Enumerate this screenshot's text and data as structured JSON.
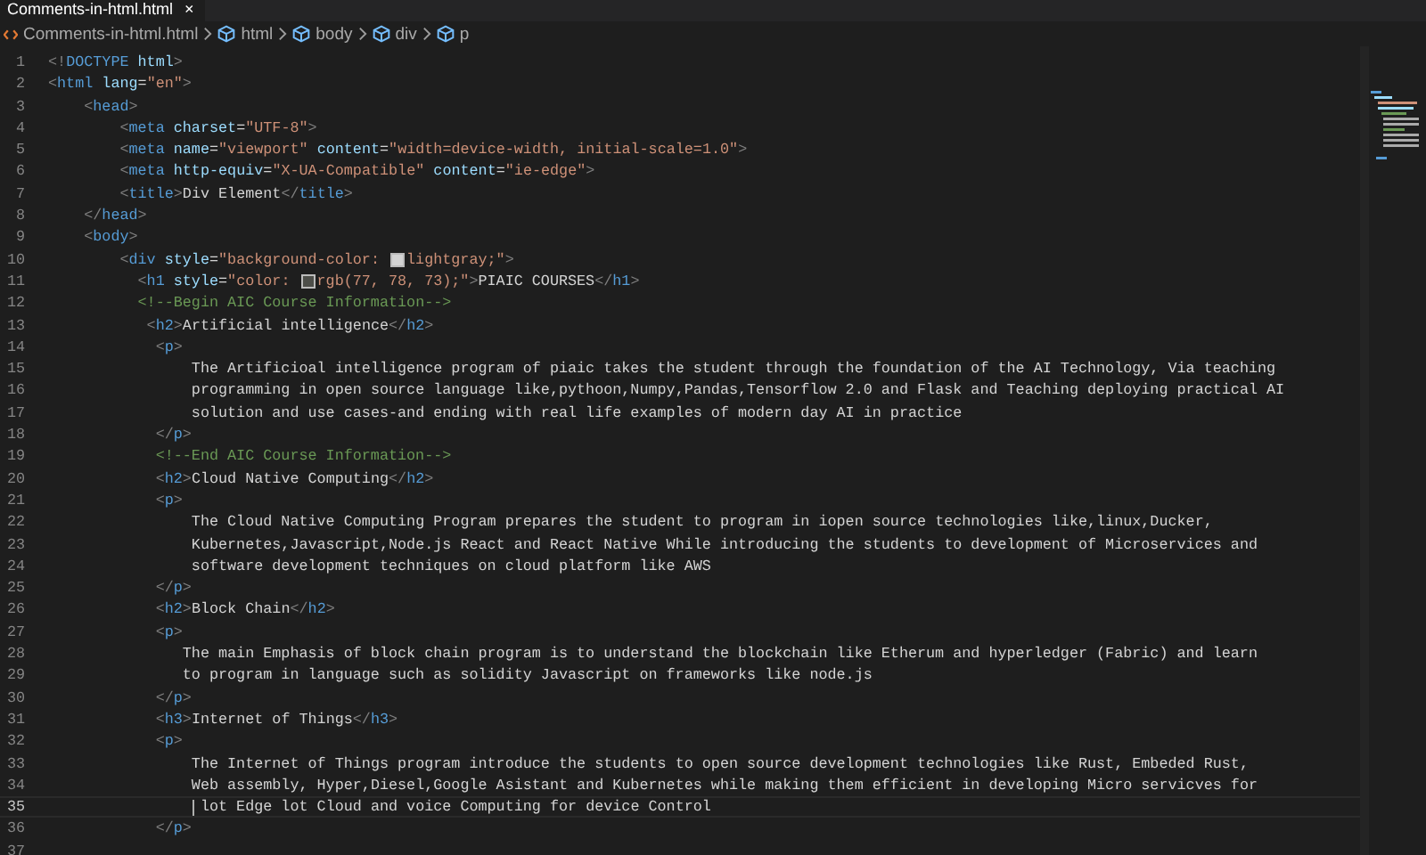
{
  "tabs": [
    {
      "label": "Comments-in-html.html",
      "close": "×",
      "selected": true
    }
  ],
  "breadcrumb": [
    {
      "label": "Comments-in-html.html",
      "kind": "file"
    },
    {
      "label": "html",
      "kind": "element"
    },
    {
      "label": "body",
      "kind": "element"
    },
    {
      "label": "div",
      "kind": "element"
    },
    {
      "label": "p",
      "kind": "element"
    }
  ],
  "editor": {
    "lines": [
      {
        "number": "1",
        "current": false,
        "tokens": [
          {
            "kind": "punct",
            "text": "<!"
          },
          {
            "kind": "tag",
            "text": "DOCTYPE"
          },
          {
            "kind": "attr",
            "text": " html"
          },
          {
            "kind": "punct",
            "text": ">"
          }
        ]
      },
      {
        "number": "2",
        "current": false,
        "tokens": [
          {
            "kind": "punct",
            "text": "<"
          },
          {
            "kind": "tag",
            "text": "html"
          },
          {
            "kind": "attr",
            "text": " lang"
          },
          {
            "kind": "text",
            "text": "="
          },
          {
            "kind": "string",
            "text": "\"en\""
          },
          {
            "kind": "punct",
            "text": ">"
          }
        ]
      },
      {
        "number": "3",
        "current": false,
        "tokens": [
          {
            "kind": "punct",
            "text": "    <"
          },
          {
            "kind": "tag",
            "text": "head"
          },
          {
            "kind": "punct",
            "text": ">"
          }
        ]
      },
      {
        "number": "4",
        "current": false,
        "tokens": [
          {
            "kind": "punct",
            "text": "        <"
          },
          {
            "kind": "tag",
            "text": "meta"
          },
          {
            "kind": "attr",
            "text": " charset"
          },
          {
            "kind": "text",
            "text": "="
          },
          {
            "kind": "string",
            "text": "\"UTF-8\""
          },
          {
            "kind": "punct",
            "text": ">"
          }
        ]
      },
      {
        "number": "5",
        "current": false,
        "tokens": [
          {
            "kind": "punct",
            "text": "        <"
          },
          {
            "kind": "tag",
            "text": "meta"
          },
          {
            "kind": "attr",
            "text": " name"
          },
          {
            "kind": "text",
            "text": "="
          },
          {
            "kind": "string",
            "text": "\"viewport\""
          },
          {
            "kind": "attr",
            "text": " content"
          },
          {
            "kind": "text",
            "text": "="
          },
          {
            "kind": "string",
            "text": "\"width=device-width, initial-scale=1.0\""
          },
          {
            "kind": "punct",
            "text": ">"
          }
        ]
      },
      {
        "number": "6",
        "current": false,
        "tokens": [
          {
            "kind": "punct",
            "text": "        <"
          },
          {
            "kind": "tag",
            "text": "meta"
          },
          {
            "kind": "attr",
            "text": " http-equiv"
          },
          {
            "kind": "text",
            "text": "="
          },
          {
            "kind": "string",
            "text": "\"X-UA-Compatible\""
          },
          {
            "kind": "attr",
            "text": " content"
          },
          {
            "kind": "text",
            "text": "="
          },
          {
            "kind": "string",
            "text": "\"ie-edge\""
          },
          {
            "kind": "punct",
            "text": ">"
          }
        ]
      },
      {
        "number": "7",
        "current": false,
        "tokens": [
          {
            "kind": "punct",
            "text": "        <"
          },
          {
            "kind": "tag",
            "text": "title"
          },
          {
            "kind": "punct",
            "text": ">"
          },
          {
            "kind": "text",
            "text": "Div Element"
          },
          {
            "kind": "punct",
            "text": "</"
          },
          {
            "kind": "tag",
            "text": "title"
          },
          {
            "kind": "punct",
            "text": ">"
          }
        ]
      },
      {
        "number": "8",
        "current": false,
        "tokens": [
          {
            "kind": "punct",
            "text": "    </"
          },
          {
            "kind": "tag",
            "text": "head"
          },
          {
            "kind": "punct",
            "text": ">"
          }
        ]
      },
      {
        "number": "9",
        "current": false,
        "tokens": [
          {
            "kind": "punct",
            "text": "    <"
          },
          {
            "kind": "tag",
            "text": "body"
          },
          {
            "kind": "punct",
            "text": ">"
          }
        ]
      },
      {
        "number": "10",
        "current": false,
        "tokens": [
          {
            "kind": "punct",
            "text": "        <"
          },
          {
            "kind": "tag",
            "text": "div"
          },
          {
            "kind": "attr",
            "text": " style"
          },
          {
            "kind": "text",
            "text": "="
          },
          {
            "kind": "string",
            "text": "\"background-color: "
          },
          {
            "kind": "swatch",
            "color": "#d3d3d3"
          },
          {
            "kind": "string",
            "text": "lightgray;\""
          },
          {
            "kind": "punct",
            "text": ">"
          }
        ]
      },
      {
        "number": "11",
        "current": false,
        "tokens": [
          {
            "kind": "punct",
            "text": "          <"
          },
          {
            "kind": "tag",
            "text": "h1"
          },
          {
            "kind": "attr",
            "text": " style"
          },
          {
            "kind": "text",
            "text": "="
          },
          {
            "kind": "string",
            "text": "\"color: "
          },
          {
            "kind": "swatch",
            "color": "#4d4e49"
          },
          {
            "kind": "string",
            "text": "rgb(77, 78, 73);\""
          },
          {
            "kind": "punct",
            "text": ">"
          },
          {
            "kind": "text",
            "text": "PIAIC COURSES"
          },
          {
            "kind": "punct",
            "text": "</"
          },
          {
            "kind": "tag",
            "text": "h1"
          },
          {
            "kind": "punct",
            "text": ">"
          }
        ]
      },
      {
        "number": "12",
        "current": false,
        "tokens": [
          {
            "kind": "comment",
            "text": "          <!--Begin AIC Course Information-->"
          }
        ]
      },
      {
        "number": "13",
        "current": false,
        "tokens": [
          {
            "kind": "punct",
            "text": "           <"
          },
          {
            "kind": "tag",
            "text": "h2"
          },
          {
            "kind": "punct",
            "text": ">"
          },
          {
            "kind": "text",
            "text": "Artificial intelligence"
          },
          {
            "kind": "punct",
            "text": "</"
          },
          {
            "kind": "tag",
            "text": "h2"
          },
          {
            "kind": "punct",
            "text": ">"
          }
        ]
      },
      {
        "number": "14",
        "current": false,
        "tokens": [
          {
            "kind": "punct",
            "text": "            <"
          },
          {
            "kind": "tag",
            "text": "p"
          },
          {
            "kind": "punct",
            "text": ">"
          }
        ]
      },
      {
        "number": "15",
        "current": false,
        "tokens": [
          {
            "kind": "text",
            "text": "                The Artificioal intelligence program of piaic takes the student through the foundation of the AI Technology, Via teaching"
          }
        ]
      },
      {
        "number": "16",
        "current": false,
        "tokens": [
          {
            "kind": "text",
            "text": "                programming in open source language like,pythoon,Numpy,Pandas,Tensorflow 2.0 and Flask and Teaching deploying practical AI"
          }
        ]
      },
      {
        "number": "17",
        "current": false,
        "tokens": [
          {
            "kind": "text",
            "text": "                solution and use cases-and ending with real life examples of modern day AI in practice"
          }
        ]
      },
      {
        "number": "18",
        "current": false,
        "tokens": [
          {
            "kind": "punct",
            "text": "            </"
          },
          {
            "kind": "tag",
            "text": "p"
          },
          {
            "kind": "punct",
            "text": ">"
          }
        ]
      },
      {
        "number": "19",
        "current": false,
        "tokens": [
          {
            "kind": "comment",
            "text": "            <!--End AIC Course Information-->"
          }
        ]
      },
      {
        "number": "20",
        "current": false,
        "tokens": [
          {
            "kind": "punct",
            "text": "            <"
          },
          {
            "kind": "tag",
            "text": "h2"
          },
          {
            "kind": "punct",
            "text": ">"
          },
          {
            "kind": "text",
            "text": "Cloud Native Computing"
          },
          {
            "kind": "punct",
            "text": "</"
          },
          {
            "kind": "tag",
            "text": "h2"
          },
          {
            "kind": "punct",
            "text": ">"
          }
        ]
      },
      {
        "number": "21",
        "current": false,
        "tokens": [
          {
            "kind": "punct",
            "text": "            <"
          },
          {
            "kind": "tag",
            "text": "p"
          },
          {
            "kind": "punct",
            "text": ">"
          }
        ]
      },
      {
        "number": "22",
        "current": false,
        "tokens": [
          {
            "kind": "text",
            "text": "                The Cloud Native Computing Program prepares the student to program in iopen source technologies like,linux,Ducker,"
          }
        ]
      },
      {
        "number": "23",
        "current": false,
        "tokens": [
          {
            "kind": "text",
            "text": "                Kubernetes,Javascript,Node.js React and React Native While introducing the students to development of Microservices and"
          }
        ]
      },
      {
        "number": "24",
        "current": false,
        "tokens": [
          {
            "kind": "text",
            "text": "                software development techniques on cloud platform like AWS"
          }
        ]
      },
      {
        "number": "25",
        "current": false,
        "tokens": [
          {
            "kind": "punct",
            "text": "            </"
          },
          {
            "kind": "tag",
            "text": "p"
          },
          {
            "kind": "punct",
            "text": ">"
          }
        ]
      },
      {
        "number": "26",
        "current": false,
        "tokens": [
          {
            "kind": "punct",
            "text": "            <"
          },
          {
            "kind": "tag",
            "text": "h2"
          },
          {
            "kind": "punct",
            "text": ">"
          },
          {
            "kind": "text",
            "text": "Block Chain"
          },
          {
            "kind": "punct",
            "text": "</"
          },
          {
            "kind": "tag",
            "text": "h2"
          },
          {
            "kind": "punct",
            "text": ">"
          }
        ]
      },
      {
        "number": "27",
        "current": false,
        "tokens": [
          {
            "kind": "punct",
            "text": "            <"
          },
          {
            "kind": "tag",
            "text": "p"
          },
          {
            "kind": "punct",
            "text": ">"
          }
        ]
      },
      {
        "number": "28",
        "current": false,
        "tokens": [
          {
            "kind": "text",
            "text": "               The main Emphasis of block chain program is to understand the blockchain like Etherum and hyperledger (Fabric) and learn"
          }
        ]
      },
      {
        "number": "29",
        "current": false,
        "tokens": [
          {
            "kind": "text",
            "text": "               to program in language such as solidity Javascript on frameworks like node.js"
          }
        ]
      },
      {
        "number": "30",
        "current": false,
        "tokens": [
          {
            "kind": "punct",
            "text": "            </"
          },
          {
            "kind": "tag",
            "text": "p"
          },
          {
            "kind": "punct",
            "text": ">"
          }
        ]
      },
      {
        "number": "31",
        "current": false,
        "tokens": [
          {
            "kind": "punct",
            "text": "            <"
          },
          {
            "kind": "tag",
            "text": "h3"
          },
          {
            "kind": "punct",
            "text": ">"
          },
          {
            "kind": "text",
            "text": "Internet of Things"
          },
          {
            "kind": "punct",
            "text": "</"
          },
          {
            "kind": "tag",
            "text": "h3"
          },
          {
            "kind": "punct",
            "text": ">"
          }
        ]
      },
      {
        "number": "32",
        "current": false,
        "tokens": [
          {
            "kind": "punct",
            "text": "            <"
          },
          {
            "kind": "tag",
            "text": "p"
          },
          {
            "kind": "punct",
            "text": ">"
          }
        ]
      },
      {
        "number": "33",
        "current": false,
        "tokens": [
          {
            "kind": "text",
            "text": "                The Internet of Things program introduce the students to open source development technologies like Rust, Embeded Rust,"
          }
        ]
      },
      {
        "number": "34",
        "current": false,
        "tokens": [
          {
            "kind": "text",
            "text": "                Web assembly, Hyper,Diesel,Google Asistant and Kubernetes while making them efficient in developing Micro servicves for"
          }
        ]
      },
      {
        "number": "35",
        "current": true,
        "tokens": [
          {
            "kind": "text",
            "text": "                 lot Edge lot Cloud and voice Computing for device Control"
          }
        ]
      },
      {
        "number": "36",
        "current": false,
        "tokens": [
          {
            "kind": "punct",
            "text": "            </"
          },
          {
            "kind": "tag",
            "text": "p"
          },
          {
            "kind": "punct",
            "text": ">"
          }
        ]
      },
      {
        "number": "37",
        "current": false
      }
    ]
  }
}
